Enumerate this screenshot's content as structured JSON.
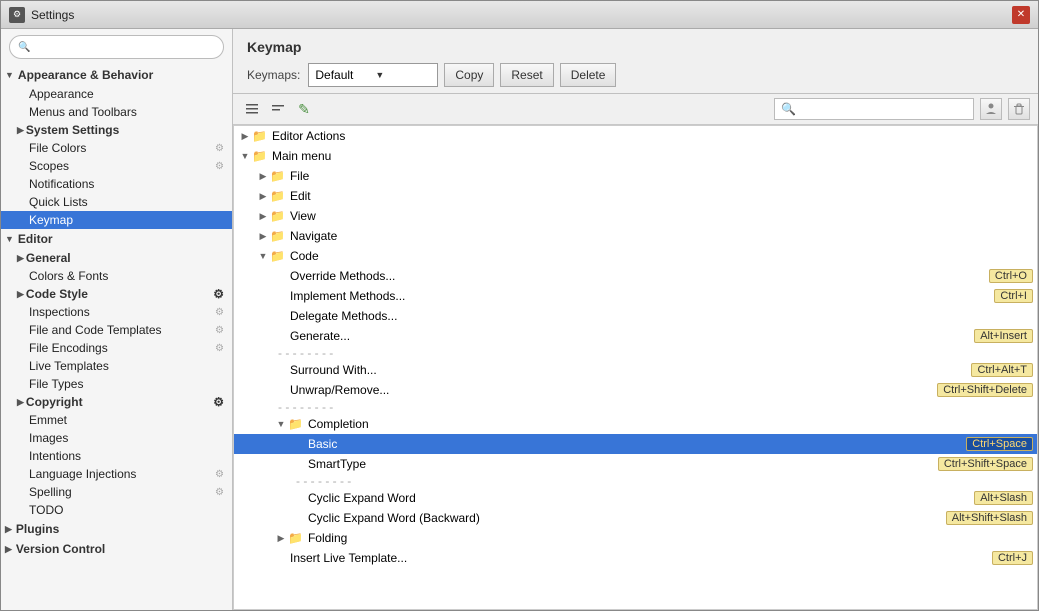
{
  "window": {
    "title": "Settings",
    "close_label": "✕"
  },
  "sidebar": {
    "search_placeholder": "",
    "sections": [
      {
        "id": "appearance-behavior",
        "label": "Appearance & Behavior",
        "expanded": true,
        "children": [
          {
            "id": "appearance",
            "label": "Appearance",
            "has_cfg": false
          },
          {
            "id": "menus-toolbars",
            "label": "Menus and Toolbars",
            "has_cfg": false
          },
          {
            "id": "system-settings",
            "label": "System Settings",
            "expanded": false,
            "is_subsection": true
          },
          {
            "id": "file-colors",
            "label": "File Colors",
            "has_cfg": true
          },
          {
            "id": "scopes",
            "label": "Scopes",
            "has_cfg": true
          },
          {
            "id": "notifications",
            "label": "Notifications",
            "has_cfg": false
          },
          {
            "id": "quick-lists",
            "label": "Quick Lists",
            "has_cfg": false
          },
          {
            "id": "keymap",
            "label": "Keymap",
            "selected": true
          }
        ]
      },
      {
        "id": "editor",
        "label": "Editor",
        "expanded": true,
        "children": [
          {
            "id": "general",
            "label": "General",
            "is_subsection": true
          },
          {
            "id": "colors-fonts",
            "label": "Colors & Fonts",
            "has_cfg": false
          },
          {
            "id": "code-style",
            "label": "Code Style",
            "has_cfg": true,
            "is_subsection": true
          },
          {
            "id": "inspections",
            "label": "Inspections",
            "has_cfg": true
          },
          {
            "id": "file-code-templates",
            "label": "File and Code Templates",
            "has_cfg": true
          },
          {
            "id": "file-encodings",
            "label": "File Encodings",
            "has_cfg": true
          },
          {
            "id": "live-templates",
            "label": "Live Templates",
            "has_cfg": false
          },
          {
            "id": "file-types",
            "label": "File Types",
            "has_cfg": false
          },
          {
            "id": "copyright",
            "label": "Copyright",
            "has_cfg": true,
            "is_subsection": true
          },
          {
            "id": "emmet",
            "label": "Emmet",
            "has_cfg": false
          },
          {
            "id": "images",
            "label": "Images",
            "has_cfg": false
          },
          {
            "id": "intentions",
            "label": "Intentions",
            "has_cfg": false
          },
          {
            "id": "language-injections",
            "label": "Language Injections",
            "has_cfg": true
          },
          {
            "id": "spelling",
            "label": "Spelling",
            "has_cfg": true
          },
          {
            "id": "todo",
            "label": "TODO",
            "has_cfg": false
          }
        ]
      },
      {
        "id": "plugins",
        "label": "Plugins",
        "expanded": false
      },
      {
        "id": "version-control",
        "label": "Version Control",
        "expanded": false
      }
    ]
  },
  "keymap": {
    "title": "Keymap",
    "keymaps_label": "Keymaps:",
    "default_option": "Default",
    "copy_label": "Copy",
    "reset_label": "Reset",
    "delete_label": "Delete",
    "search_placeholder": "🔍",
    "toolbar": {
      "expand_icon": "≡",
      "collapse_icon": "≡",
      "edit_icon": "✎"
    },
    "tree": [
      {
        "id": "editor-actions",
        "type": "folder",
        "label": "Editor Actions",
        "indent": 0,
        "expanded": false
      },
      {
        "id": "main-menu",
        "type": "folder",
        "label": "Main menu",
        "indent": 0,
        "expanded": true
      },
      {
        "id": "file",
        "type": "folder",
        "label": "File",
        "indent": 1,
        "expanded": false
      },
      {
        "id": "edit",
        "type": "folder",
        "label": "Edit",
        "indent": 1,
        "expanded": false
      },
      {
        "id": "view",
        "type": "folder",
        "label": "View",
        "indent": 1,
        "expanded": false
      },
      {
        "id": "navigate",
        "type": "folder",
        "label": "Navigate",
        "indent": 1,
        "expanded": false
      },
      {
        "id": "code",
        "type": "folder",
        "label": "Code",
        "indent": 1,
        "expanded": true
      },
      {
        "id": "override-methods",
        "type": "item",
        "label": "Override Methods...",
        "indent": 2,
        "shortcut": "Ctrl+O"
      },
      {
        "id": "implement-methods",
        "type": "item",
        "label": "Implement Methods...",
        "indent": 2,
        "shortcut": "Ctrl+I"
      },
      {
        "id": "delegate-methods",
        "type": "item",
        "label": "Delegate Methods...",
        "indent": 2,
        "shortcut": ""
      },
      {
        "id": "generate",
        "type": "item",
        "label": "Generate...",
        "indent": 2,
        "shortcut": "Alt+Insert"
      },
      {
        "id": "sep1",
        "type": "separator",
        "indent": 2
      },
      {
        "id": "surround-with",
        "type": "item",
        "label": "Surround With...",
        "indent": 2,
        "shortcut": "Ctrl+Alt+T"
      },
      {
        "id": "unwrap-remove",
        "type": "item",
        "label": "Unwrap/Remove...",
        "indent": 2,
        "shortcut": "Ctrl+Shift+Delete"
      },
      {
        "id": "sep2",
        "type": "separator",
        "indent": 2
      },
      {
        "id": "completion",
        "type": "folder",
        "label": "Completion",
        "indent": 2,
        "expanded": true
      },
      {
        "id": "basic",
        "type": "item",
        "label": "Basic",
        "indent": 3,
        "shortcut": "Ctrl+Space",
        "selected": true
      },
      {
        "id": "smarttype",
        "type": "item",
        "label": "SmartType",
        "indent": 3,
        "shortcut": "Ctrl+Shift+Space"
      },
      {
        "id": "sep3",
        "type": "separator",
        "indent": 3
      },
      {
        "id": "cyclic-expand",
        "type": "item",
        "label": "Cyclic Expand Word",
        "indent": 3,
        "shortcut": "Alt+Slash"
      },
      {
        "id": "cyclic-expand-backward",
        "type": "item",
        "label": "Cyclic Expand Word (Backward)",
        "indent": 3,
        "shortcut": "Alt+Shift+Slash"
      },
      {
        "id": "folding",
        "type": "folder",
        "label": "Folding",
        "indent": 2,
        "expanded": false
      },
      {
        "id": "insert-live-template",
        "type": "item",
        "label": "Insert Live Template...",
        "indent": 2,
        "shortcut": "Ctrl+J"
      }
    ]
  }
}
